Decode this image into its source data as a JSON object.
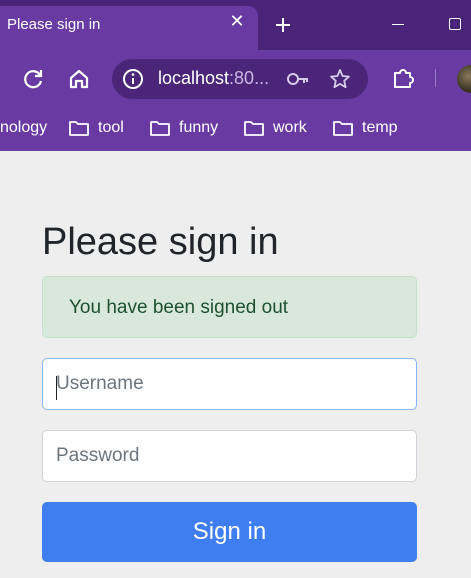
{
  "browser": {
    "tab_title": "Please sign in",
    "tab_close": "✕",
    "url": {
      "host": "localhost",
      "rest": ":80..."
    },
    "bookmarks": [
      {
        "label": "nology",
        "icon": "none"
      },
      {
        "label": "tool",
        "icon": "folder-icon"
      },
      {
        "label": "funny",
        "icon": "folder-icon"
      },
      {
        "label": "work",
        "icon": "folder-icon"
      },
      {
        "label": "temp",
        "icon": "folder-icon"
      }
    ],
    "theme_color": "#6a3aa3"
  },
  "page": {
    "heading": "Please sign in",
    "alert": {
      "message": "You have been signed out",
      "color": "#d8e9dc"
    },
    "username_placeholder": "Username",
    "password_placeholder": "Password",
    "submit_label": "Sign in",
    "accent_color": "#3f7ef0"
  }
}
